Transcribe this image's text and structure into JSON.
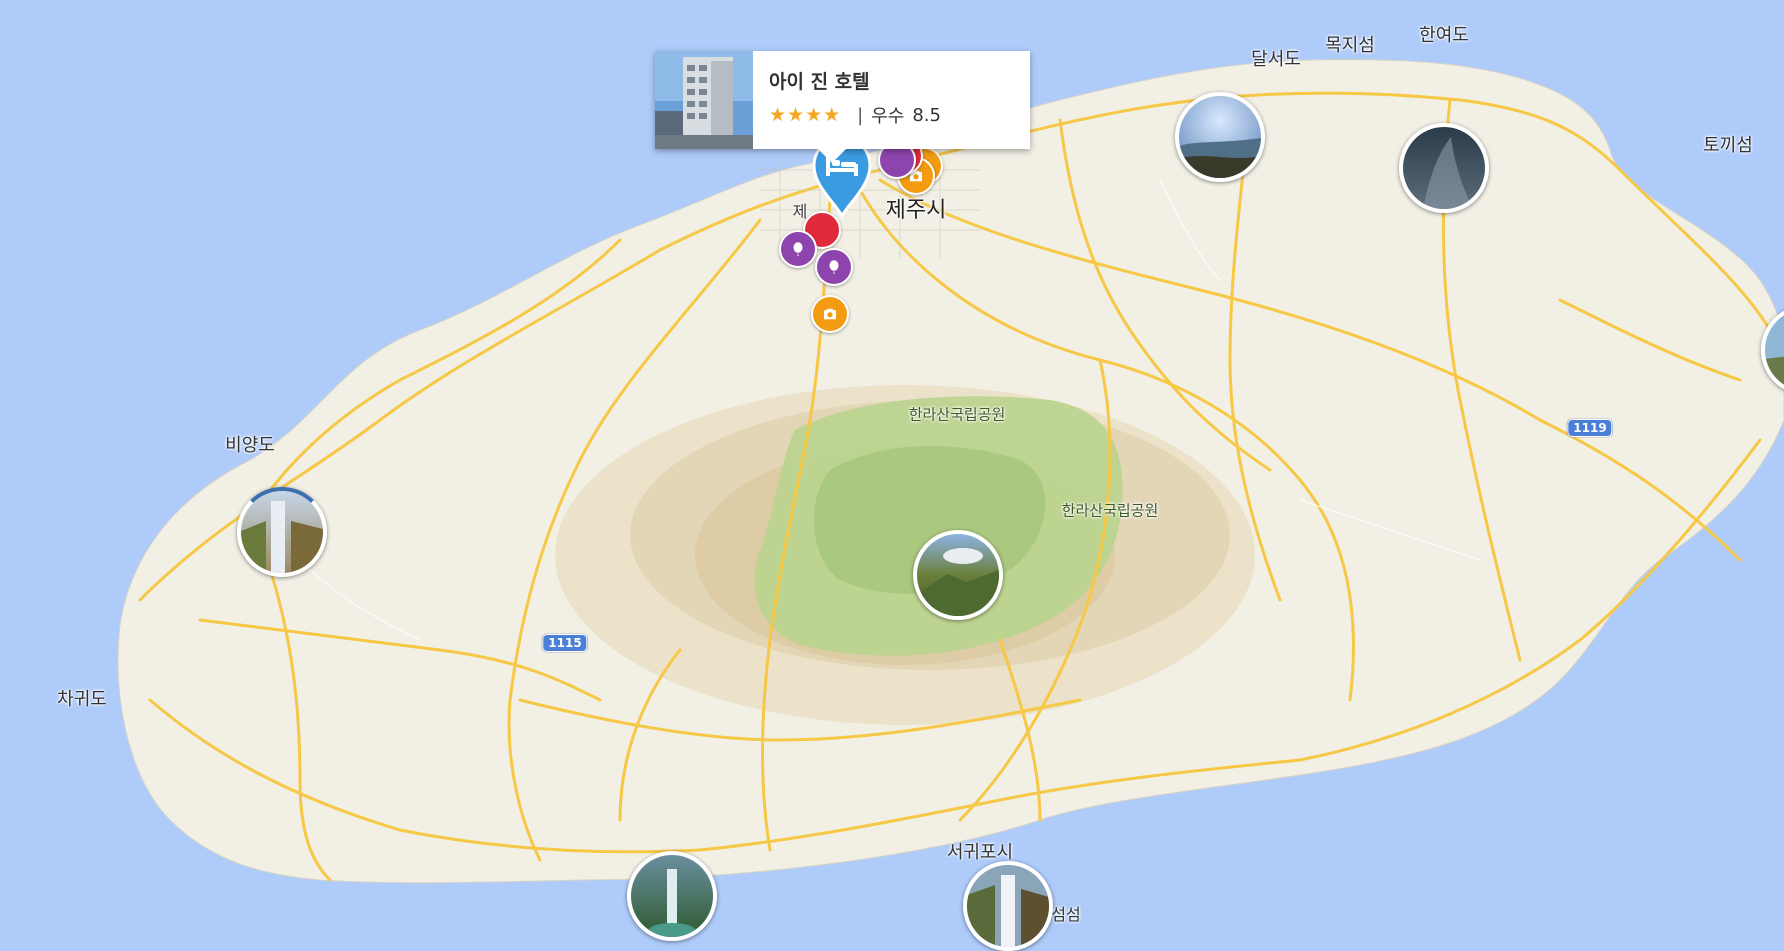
{
  "map": {
    "city_label": "제주시",
    "city_label_partial": "제",
    "park_labels": [
      "한라산국립공원",
      "한라산국립공원"
    ],
    "island_labels": {
      "dalseodo": "달서도",
      "mokjiseom": "목지섬",
      "hanyeodo": "한여도",
      "tokkiseom": "토끼섬",
      "biyangdo": "비양도",
      "chagwido": "차귀도",
      "seogwipo": "서귀포시",
      "seom_partial": "섬섬"
    },
    "road_shields": [
      "1119",
      "1115"
    ]
  },
  "hotel_popup": {
    "name": "아이 진 호텔",
    "stars": "★★★★",
    "separator": "|",
    "rating_label": "우수",
    "rating_score": "8.5"
  },
  "colors": {
    "sea": "#aecbfa",
    "land": "#f2efe5",
    "park": "#b9d48e",
    "highland": "#e3d6b6",
    "road": "#f6c845",
    "pin": "#3a9be0",
    "marker_orange": "#f39c12",
    "marker_purple": "#8e44ad",
    "marker_red": "#e0293a",
    "star": "#f5a623"
  }
}
